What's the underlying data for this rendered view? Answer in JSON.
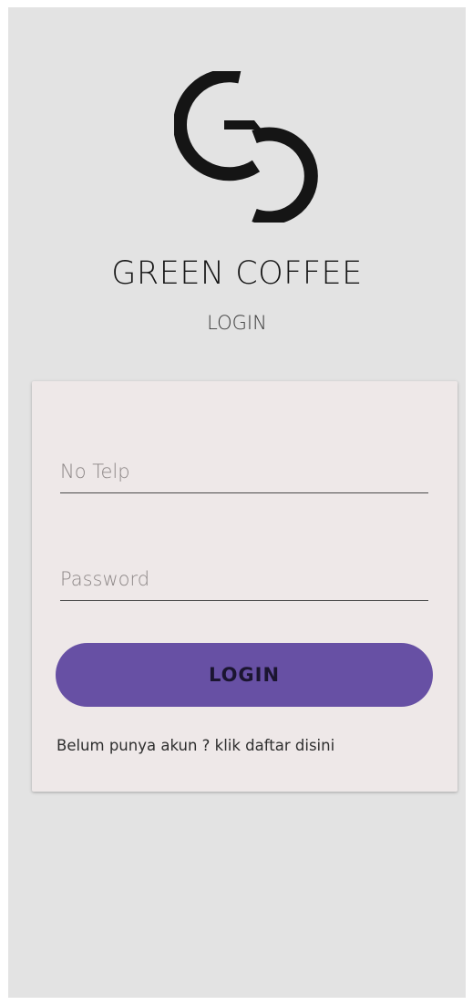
{
  "header": {
    "app_title": "GREEN COFFEE",
    "page_subtitle": "LOGIN"
  },
  "logo": {
    "icon": "gc-monogram-icon",
    "color": "#151515"
  },
  "form": {
    "phone_placeholder": "No Telp",
    "phone_value": "",
    "password_placeholder": "Password",
    "password_value": "",
    "login_label": "LOGIN",
    "register_text": "Belum punya akun ? klik daftar disini"
  },
  "colors": {
    "background": "#e3e3e3",
    "card": "#eee8e8",
    "button": "#6750a4",
    "button_text": "#1b1530"
  }
}
